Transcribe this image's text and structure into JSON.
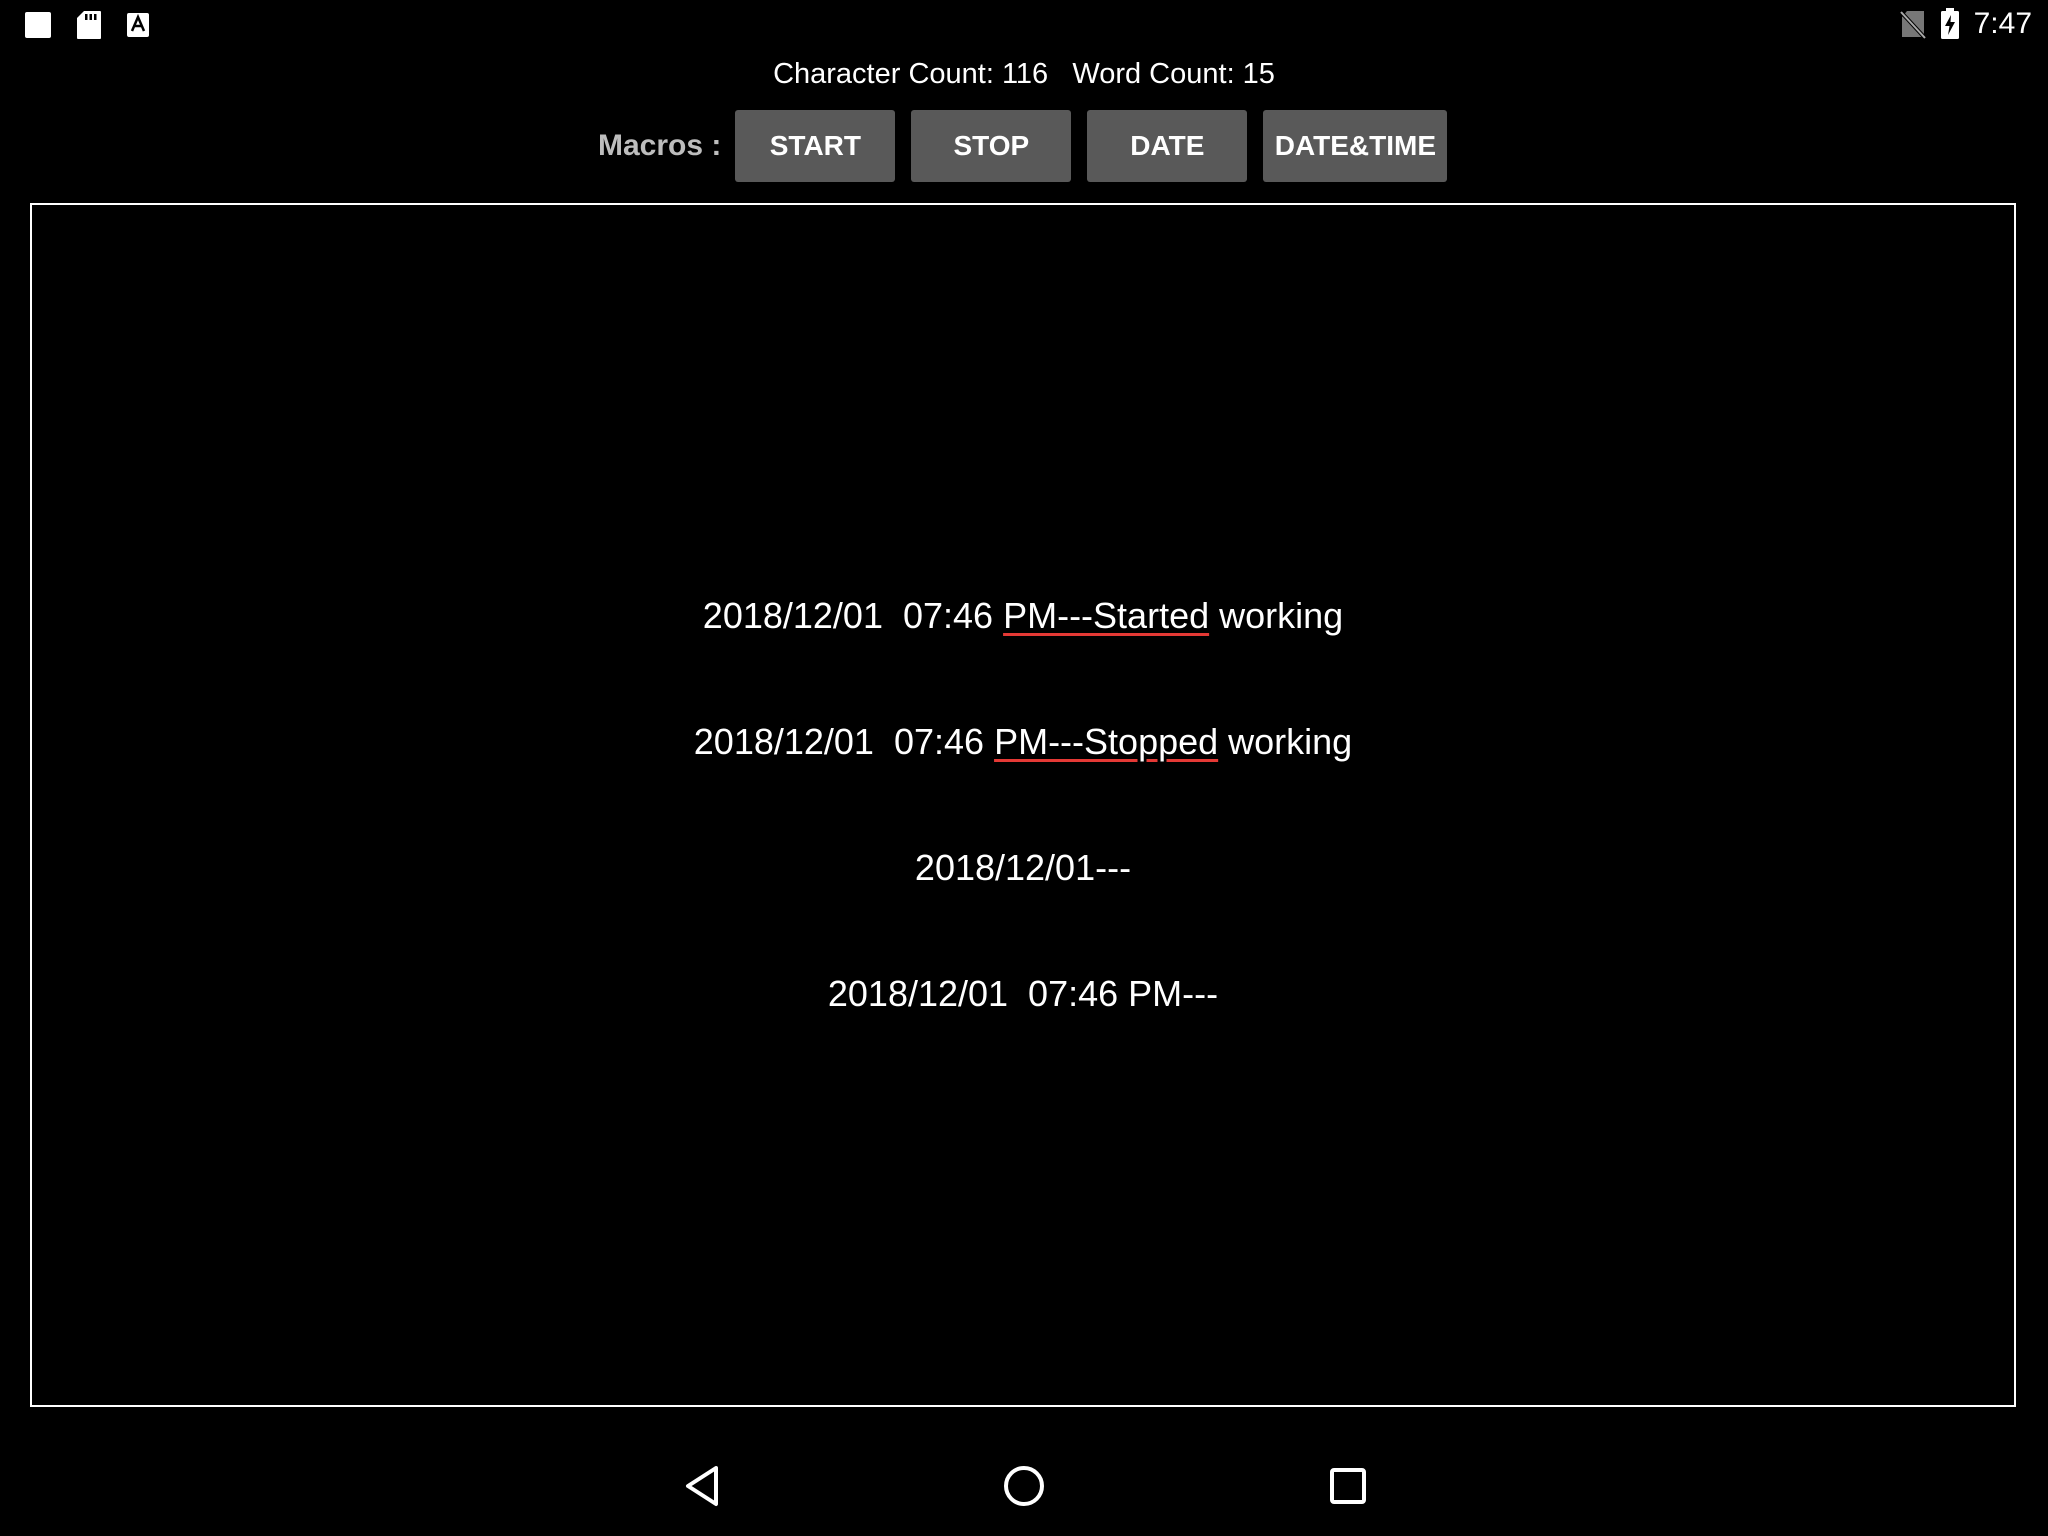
{
  "status_bar": {
    "left_icons": [
      "image-icon",
      "sd-card-icon",
      "keyboard-a-icon"
    ],
    "right_icons": [
      "no-sim-icon",
      "battery-charging-icon"
    ],
    "time": "7:47"
  },
  "counts": {
    "character_count": "Character Count: 116",
    "word_count": "Word Count: 15"
  },
  "macros": {
    "label": "Macros :",
    "buttons": {
      "start": "START",
      "stop": "STOP",
      "date": "DATE",
      "datetime": "DATE&TIME"
    }
  },
  "editor": {
    "lines": [
      {
        "prefix": "2018/12/01  07:46 ",
        "underlined": "PM---Started",
        "suffix": " working"
      },
      {
        "prefix": "2018/12/01  07:46 ",
        "underlined": "PM---Stopped",
        "suffix": " working"
      },
      {
        "prefix": "2018/12/01---",
        "underlined": "",
        "suffix": ""
      },
      {
        "prefix": "2018/12/01  07:46 PM---",
        "underlined": "",
        "suffix": ""
      }
    ]
  },
  "nav_bar": {
    "icons": [
      "back-icon",
      "home-icon",
      "recents-icon"
    ]
  },
  "colors": {
    "background": "#000000",
    "button": "#595959",
    "spellcheck_underline": "#e53935",
    "macros_label": "#bdbdbd"
  }
}
